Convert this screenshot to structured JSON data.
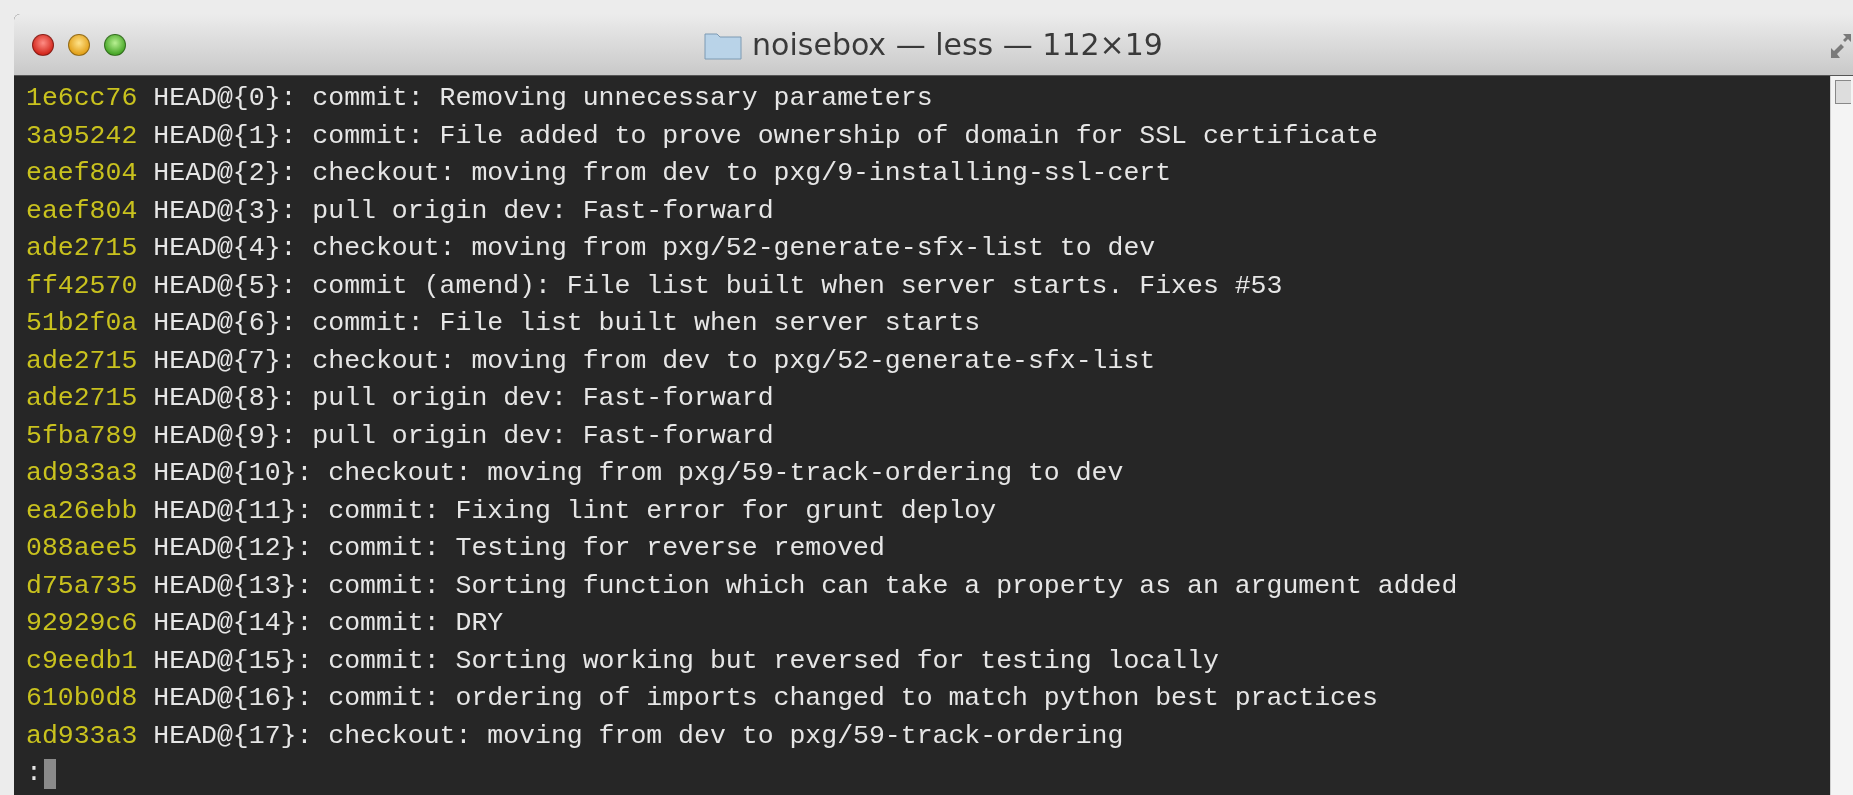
{
  "window": {
    "title": "noisebox — less — 112×19"
  },
  "log": [
    {
      "hash": "1e6cc76",
      "text": "HEAD@{0}: commit: Removing unnecessary parameters"
    },
    {
      "hash": "3a95242",
      "text": "HEAD@{1}: commit: File added to prove ownership of domain for SSL certificate"
    },
    {
      "hash": "eaef804",
      "text": "HEAD@{2}: checkout: moving from dev to pxg/9-installing-ssl-cert"
    },
    {
      "hash": "eaef804",
      "text": "HEAD@{3}: pull origin dev: Fast-forward"
    },
    {
      "hash": "ade2715",
      "text": "HEAD@{4}: checkout: moving from pxg/52-generate-sfx-list to dev"
    },
    {
      "hash": "ff42570",
      "text": "HEAD@{5}: commit (amend): File list built when server starts. Fixes #53"
    },
    {
      "hash": "51b2f0a",
      "text": "HEAD@{6}: commit: File list built when server starts"
    },
    {
      "hash": "ade2715",
      "text": "HEAD@{7}: checkout: moving from dev to pxg/52-generate-sfx-list"
    },
    {
      "hash": "ade2715",
      "text": "HEAD@{8}: pull origin dev: Fast-forward"
    },
    {
      "hash": "5fba789",
      "text": "HEAD@{9}: pull origin dev: Fast-forward"
    },
    {
      "hash": "ad933a3",
      "text": "HEAD@{10}: checkout: moving from pxg/59-track-ordering to dev"
    },
    {
      "hash": "ea26ebb",
      "text": "HEAD@{11}: commit: Fixing lint error for grunt deploy"
    },
    {
      "hash": "088aee5",
      "text": "HEAD@{12}: commit: Testing for reverse removed"
    },
    {
      "hash": "d75a735",
      "text": "HEAD@{13}: commit: Sorting function which can take a property as an argument added"
    },
    {
      "hash": "92929c6",
      "text": "HEAD@{14}: commit: DRY"
    },
    {
      "hash": "c9eedb1",
      "text": "HEAD@{15}: commit: Sorting working but reversed for testing locally"
    },
    {
      "hash": "610b0d8",
      "text": "HEAD@{16}: commit: ordering of imports changed to match python best practices"
    },
    {
      "hash": "ad933a3",
      "text": "HEAD@{17}: checkout: moving from dev to pxg/59-track-ordering"
    }
  ],
  "prompt": ":"
}
